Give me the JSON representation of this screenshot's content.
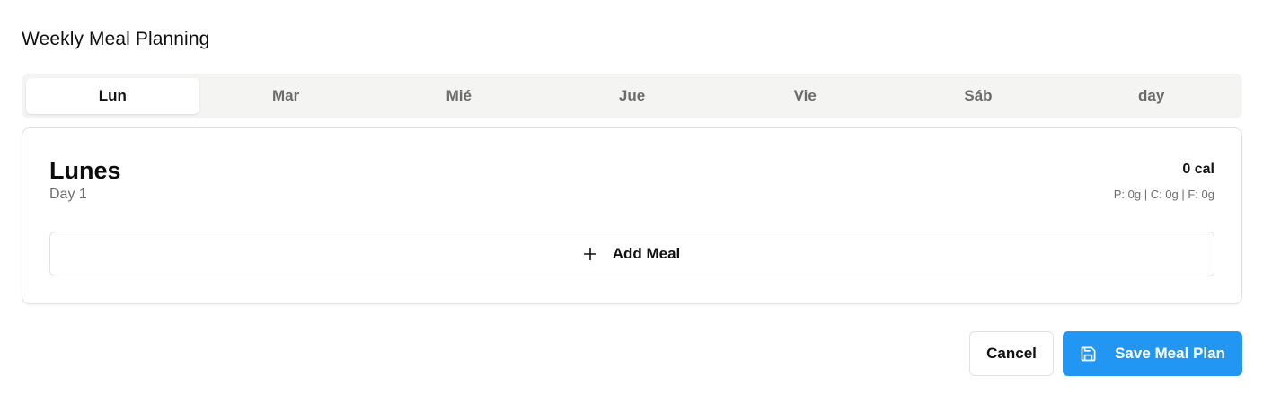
{
  "title": "Weekly Meal Planning",
  "tabs": [
    {
      "label": "Lun",
      "active": true
    },
    {
      "label": "Mar",
      "active": false
    },
    {
      "label": "Mié",
      "active": false
    },
    {
      "label": "Jue",
      "active": false
    },
    {
      "label": "Vie",
      "active": false
    },
    {
      "label": "Sáb",
      "active": false
    },
    {
      "label": "day",
      "active": false
    }
  ],
  "day": {
    "name": "Lunes",
    "subtitle": "Day 1",
    "calories": "0 cal",
    "macros": "P: 0g | C: 0g | F: 0g"
  },
  "add_meal": {
    "label": "Add Meal",
    "icon": "plus-icon"
  },
  "actions": {
    "cancel_label": "Cancel",
    "save_label": "Save Meal Plan",
    "save_icon": "save-icon"
  },
  "colors": {
    "accent": "#2196f3",
    "tab_bg": "#f4f4f2",
    "muted_text": "#6d6d6d"
  }
}
